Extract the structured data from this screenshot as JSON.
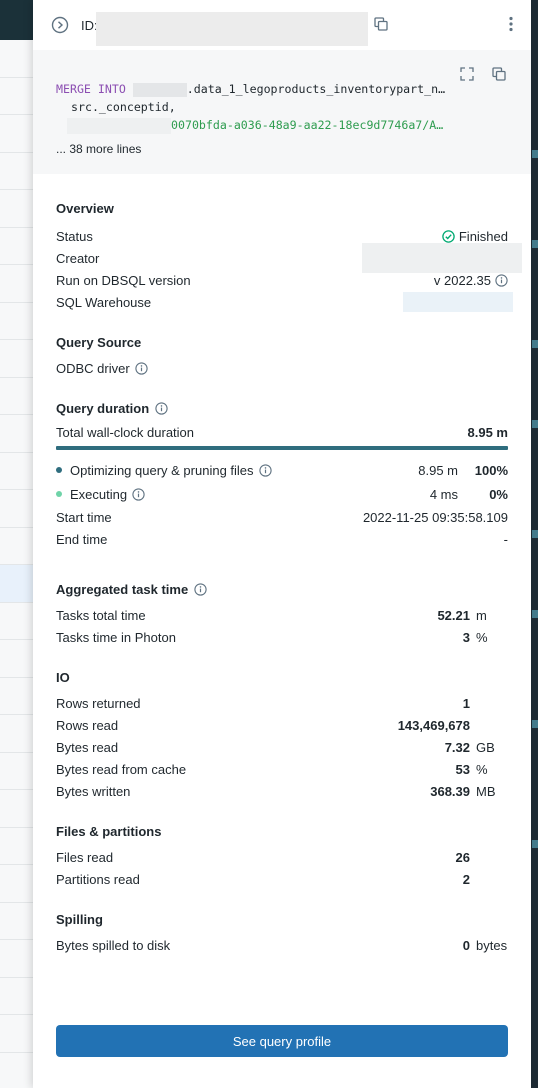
{
  "header": {
    "id_label": "ID:"
  },
  "code": {
    "line1_kw": "MERGE INTO",
    "line1_rest": ".data_1_legoproducts_inventorypart_n…",
    "line2": "src._conceptid,",
    "line3": "0070bfda-a036-48a9-aa22-18ec9d7746a7/A…",
    "more_lines": "... 38 more lines"
  },
  "overview": {
    "title": "Overview",
    "status_label": "Status",
    "status_value": "Finished",
    "creator_label": "Creator",
    "version_label": "Run on DBSQL version",
    "version_value": "v 2022.35",
    "warehouse_label": "SQL Warehouse"
  },
  "query_source": {
    "title": "Query Source",
    "driver": "ODBC driver"
  },
  "duration": {
    "title": "Query duration",
    "total_label": "Total wall-clock duration",
    "total_value": "8.95 m",
    "rows": [
      {
        "label": "Optimizing query & pruning files",
        "time": "8.95 m",
        "pct": "100%",
        "dot_color": "#2f6d7e"
      },
      {
        "label": "Executing",
        "time": "4 ms",
        "pct": "0%",
        "dot_color": "#6fd3a8"
      }
    ],
    "start_label": "Start time",
    "start_value": "2022-11-25 09:35:58.109",
    "end_label": "End time",
    "end_value": "-"
  },
  "aggregated": {
    "title": "Aggregated task time",
    "rows": [
      {
        "label": "Tasks total time",
        "value": "52.21",
        "unit": "m"
      },
      {
        "label": "Tasks time in Photon",
        "value": "3",
        "unit": "%"
      }
    ]
  },
  "io": {
    "title": "IO",
    "rows": [
      {
        "label": "Rows returned",
        "value": "1",
        "unit": ""
      },
      {
        "label": "Rows read",
        "value": "143,469,678",
        "unit": ""
      },
      {
        "label": "Bytes read",
        "value": "7.32",
        "unit": "GB"
      },
      {
        "label": "Bytes read from cache",
        "value": "53",
        "unit": "%"
      },
      {
        "label": "Bytes written",
        "value": "368.39",
        "unit": "MB"
      }
    ]
  },
  "files": {
    "title": "Files & partitions",
    "rows": [
      {
        "label": "Files read",
        "value": "26",
        "unit": ""
      },
      {
        "label": "Partitions read",
        "value": "2",
        "unit": ""
      }
    ]
  },
  "spilling": {
    "title": "Spilling",
    "rows": [
      {
        "label": "Bytes spilled to disk",
        "value": "0",
        "unit": "bytes"
      }
    ]
  },
  "cta_label": "See query profile",
  "colors": {
    "accent": "#2272b4",
    "duration_bar": "#2f6d7e",
    "success": "#00a972"
  }
}
